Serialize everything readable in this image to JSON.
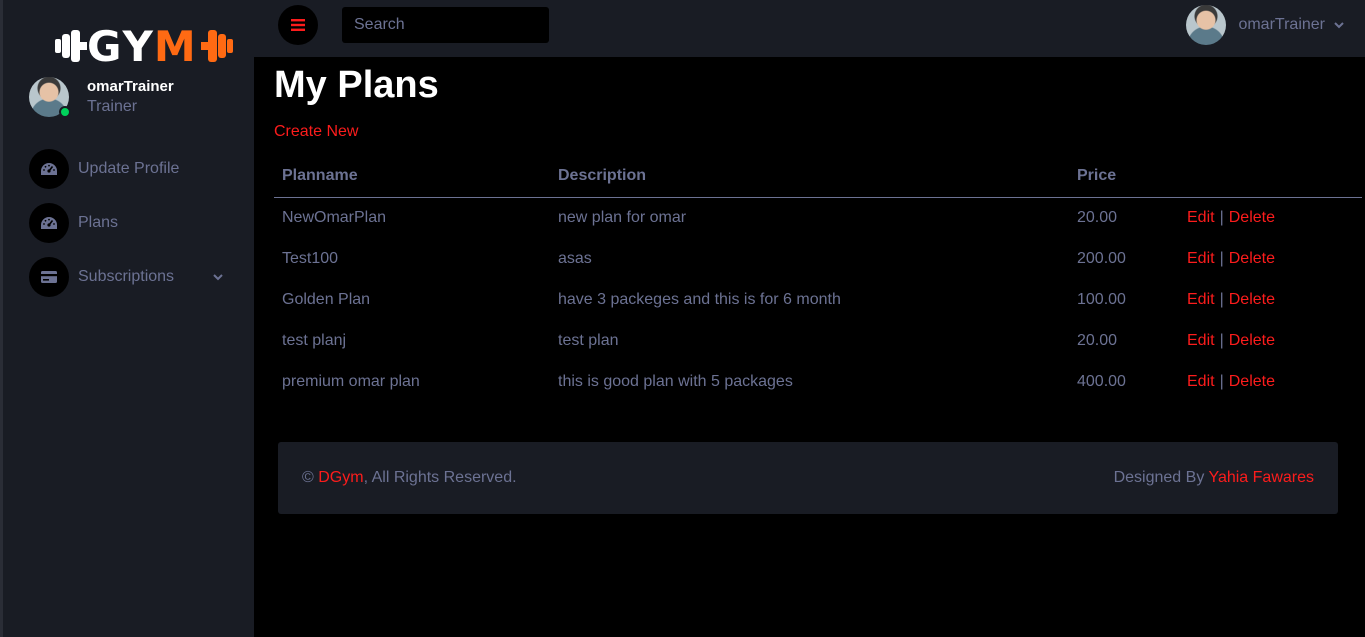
{
  "brand": {
    "logo_text": "GYM",
    "accent": "#fc1c1c",
    "logo_color": "#ff6a13"
  },
  "sidebar": {
    "profile": {
      "name": "omarTrainer",
      "role": "Trainer"
    },
    "items": [
      {
        "label": "Update Profile",
        "icon": "speedometer-icon"
      },
      {
        "label": "Plans",
        "icon": "speedometer-icon"
      },
      {
        "label": "Subscriptions",
        "icon": "credit-card-icon",
        "has_submenu": true
      }
    ]
  },
  "navbar": {
    "search_placeholder": "Search",
    "user_name": "omarTrainer"
  },
  "main": {
    "title": "My Plans",
    "create_label": "Create New",
    "table": {
      "headers": [
        "Planname",
        "Description",
        "Price"
      ],
      "edit_label": "Edit",
      "delete_label": "Delete",
      "separator": "|",
      "rows": [
        {
          "name": "NewOmarPlan",
          "description": "new plan for omar",
          "price": "20.00"
        },
        {
          "name": "Test100",
          "description": "asas",
          "price": "200.00"
        },
        {
          "name": "Golden Plan",
          "description": "have 3 packeges and this is for 6 month",
          "price": "100.00"
        },
        {
          "name": "test planj",
          "description": "test plan",
          "price": "20.00"
        },
        {
          "name": "premium omar plan",
          "description": "this is good plan with 5 packages",
          "price": "400.00"
        }
      ]
    }
  },
  "footer": {
    "copyright_symbol": "©",
    "brand_link": "DGym",
    "rights_text": ", All Rights Reserved.",
    "designed_by_text": "Designed By",
    "designer_link": "Yahia Fawares"
  }
}
